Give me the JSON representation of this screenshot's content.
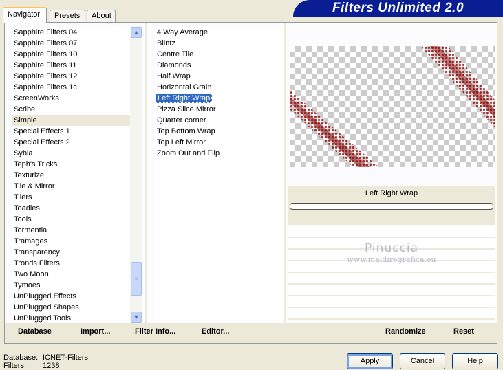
{
  "banner": {
    "title": "Filters Unlimited 2.0"
  },
  "tabs": [
    {
      "label": "Navigator",
      "active": true
    },
    {
      "label": "Presets",
      "active": false
    },
    {
      "label": "About",
      "active": false
    }
  ],
  "categories": [
    "Sapphire Filters 04",
    "Sapphire Filters 07",
    "Sapphire Filters 10",
    "Sapphire Filters 11",
    "Sapphire Filters 12",
    "Sapphire Filters 1c",
    "ScreenWorks",
    "Scribe",
    "Simple",
    "Special Effects 1",
    "Special Effects 2",
    "Sybia",
    "Teph's Tricks",
    "Texturize",
    "Tile & Mirror",
    "Tilers",
    "Toadies",
    "Tools",
    "Tormentia",
    "Tramages",
    "Transparency",
    "Tronds Filters",
    "Two Moon",
    "Tymoes",
    "UnPlugged Effects",
    "UnPlugged Shapes",
    "UnPlugged Tools"
  ],
  "selected_category": "Simple",
  "filters": [
    "4 Way Average",
    "Blintz",
    "Centre Tile",
    "Diamonds",
    "Half Wrap",
    "Horizontal Grain",
    "Left Right Wrap",
    "Pizza Slice Mirror",
    "Quarter corner",
    "Top Bottom Wrap",
    "Top Left Mirror",
    "Zoom Out and Flip"
  ],
  "selected_filter": "Left Right Wrap",
  "preview": {
    "filter_name": "Left Right Wrap",
    "progress": 0
  },
  "watermark": {
    "line1": "Pinuccia",
    "line2": "www.maidiregrafica.eu"
  },
  "bottom_links": {
    "database": "Database",
    "import": "Import...",
    "filter_info": "Filter Info...",
    "editor": "Editor...",
    "randomize": "Randomize",
    "reset": "Reset"
  },
  "footer": {
    "database_label": "Database:",
    "database_value": "ICNET-Filters",
    "filters_label": "Filters:",
    "filters_value": "1238"
  },
  "buttons": {
    "apply": "Apply",
    "cancel": "Cancel",
    "help": "Help"
  },
  "colors": {
    "banner": "#0a1e94",
    "selection": "#316ac5",
    "preview_pattern": "#a01818"
  },
  "icons": {
    "scroll_up": "chevron-up-icon",
    "scroll_down": "chevron-down-icon"
  }
}
